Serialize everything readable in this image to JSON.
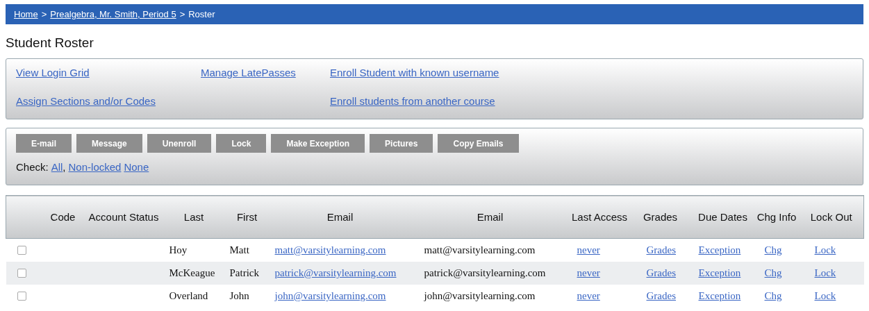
{
  "breadcrumb": {
    "links": [
      "Home",
      "Prealgebra, Mr. Smith, Period 5"
    ],
    "separators": [
      ">",
      ">"
    ],
    "current": "Roster"
  },
  "title": "Student Roster",
  "actions": {
    "row1": [
      "View Login Grid",
      "Manage LatePasses",
      "Enroll Student with known username"
    ],
    "row2": [
      "Assign Sections and/or Codes",
      "Enroll students from another course"
    ]
  },
  "buttons": [
    "E-mail",
    "Message",
    "Unenroll",
    "Lock",
    "Make Exception",
    "Pictures",
    "Copy Emails"
  ],
  "check": {
    "label": "Check:",
    "items": [
      {
        "kind": "link",
        "text": "All"
      },
      {
        "kind": "text",
        "text": ","
      },
      {
        "kind": "link",
        "text": "Non-locked"
      },
      {
        "kind": "link",
        "text": "None"
      }
    ]
  },
  "table": {
    "columns": [
      "Code",
      "Account Status",
      "Last",
      "First",
      "Email",
      "Email",
      "Last Access",
      "Grades",
      "Due Dates",
      "Chg Info",
      "Lock Out"
    ],
    "rows": [
      {
        "checked": false,
        "last": "Hoy",
        "first": "Matt",
        "email_link": "matt@varsitylearning.com",
        "email": "matt@varsitylearning.com",
        "last_access": "never",
        "grades": "Grades",
        "due_dates": "Exception",
        "chg_info": "Chg",
        "lock_out": "Lock"
      },
      {
        "checked": false,
        "last": "McKeague",
        "first": "Patrick",
        "email_link": "patrick@varsitylearning.com",
        "email": "patrick@varsitylearning.com",
        "last_access": "never",
        "grades": "Grades",
        "due_dates": "Exception",
        "chg_info": "Chg",
        "lock_out": "Lock"
      },
      {
        "checked": false,
        "last": "Overland",
        "first": "John",
        "email_link": "john@varsitylearning.com",
        "email": "john@varsitylearning.com",
        "last_access": "never",
        "grades": "Grades",
        "due_dates": "Exception",
        "chg_info": "Chg",
        "lock_out": "Lock"
      }
    ]
  }
}
